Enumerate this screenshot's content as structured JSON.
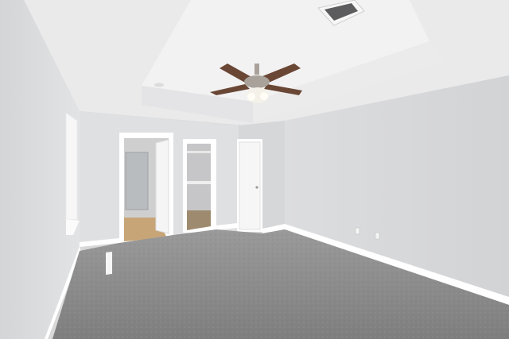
{
  "scene": {
    "subject": "empty-bedroom-interior",
    "colors": {
      "wall_light": "#e6e6e8",
      "wall_mid": "#d6d7d9",
      "wall_shadow": "#c9cacc",
      "ceiling": "#eeeeef",
      "tray_ceiling": "#f3f3f4",
      "trim": "#ffffff",
      "carpet": "#8c8c8c",
      "carpet_dark": "#7c7c7c",
      "bath_floor": "#c9a77c",
      "fan_blade": "#6a4735",
      "fan_metal": "#a8a29a",
      "fan_light": "#f4f1e8"
    }
  }
}
